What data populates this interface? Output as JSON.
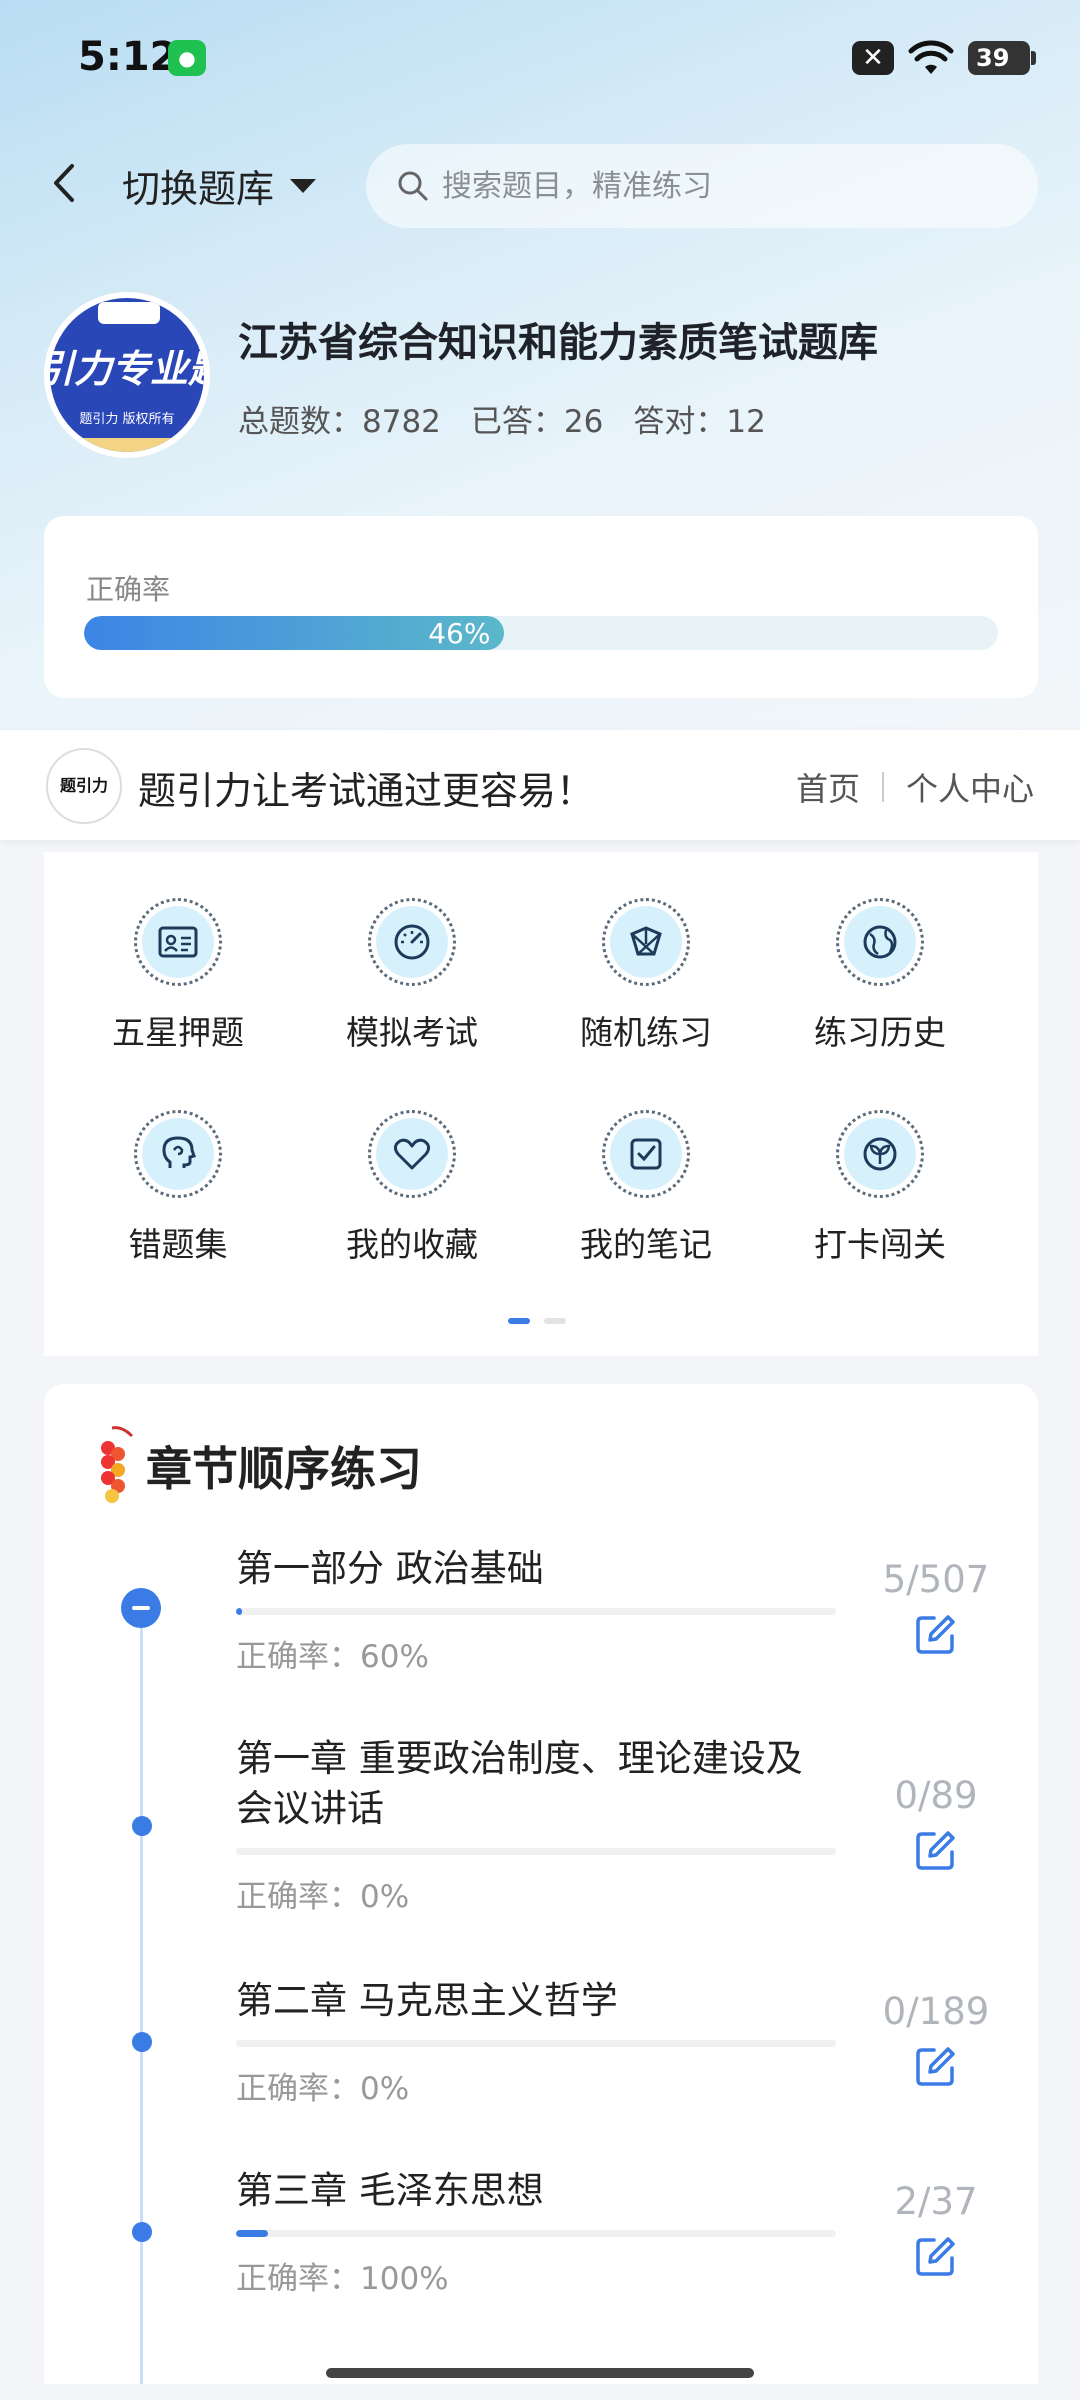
{
  "status_bar": {
    "time": "5:12",
    "battery": "39",
    "icons": [
      "wechat-icon",
      "close-notification-icon",
      "wifi-icon",
      "battery-icon"
    ]
  },
  "header": {
    "switch_label": "切换题库",
    "search_placeholder": "搜索题目，精准练习"
  },
  "library": {
    "logo_text": "引力专业题",
    "logo_sub": "题引力 版权所有",
    "title": "江苏省综合知识和能力素质笔试题库",
    "stats": [
      {
        "label": "总题数：",
        "value": "8782"
      },
      {
        "label": "已答：",
        "value": "26"
      },
      {
        "label": "答对：",
        "value": "12"
      }
    ]
  },
  "accuracy": {
    "label": "正确率",
    "percent_text": "46%",
    "fraction": 0.46
  },
  "promo": {
    "logo_text": "题引力",
    "text": "题引力让考试通过更容易！",
    "links": [
      "首页",
      "个人中心"
    ]
  },
  "features": [
    {
      "label": "五星押题",
      "icon": "id-card-icon"
    },
    {
      "label": "模拟考试",
      "icon": "speedometer-icon"
    },
    {
      "label": "随机练习",
      "icon": "shuffle-icon"
    },
    {
      "label": "练习历史",
      "icon": "globe-icon"
    },
    {
      "label": "错题集",
      "icon": "head-icon"
    },
    {
      "label": "我的收藏",
      "icon": "heart-icon"
    },
    {
      "label": "我的笔记",
      "icon": "notebook-icon"
    },
    {
      "label": "打卡闯关",
      "icon": "sprout-icon"
    }
  ],
  "chapters": {
    "title": "章节顺序练习",
    "items": [
      {
        "name": "第一部分 政治基础",
        "acc_label": "正确率：",
        "acc": "60%",
        "count": "5/507",
        "progress": 0.01
      },
      {
        "name": "第一章 重要政治制度、理论建设及会议讲话",
        "acc_label": "正确率：",
        "acc": "0%",
        "count": "0/89",
        "progress": 0
      },
      {
        "name": "第二章 马克思主义哲学",
        "acc_label": "正确率：",
        "acc": "0%",
        "count": "0/189",
        "progress": 0
      },
      {
        "name": "第三章 毛泽东思想",
        "acc_label": "正确率：",
        "acc": "100%",
        "count": "2/37",
        "progress": 0.054
      }
    ]
  },
  "colors": {
    "accent": "#3a7be6",
    "teal": "#5bb8c9",
    "icon_bg": "#d6f1fb"
  }
}
